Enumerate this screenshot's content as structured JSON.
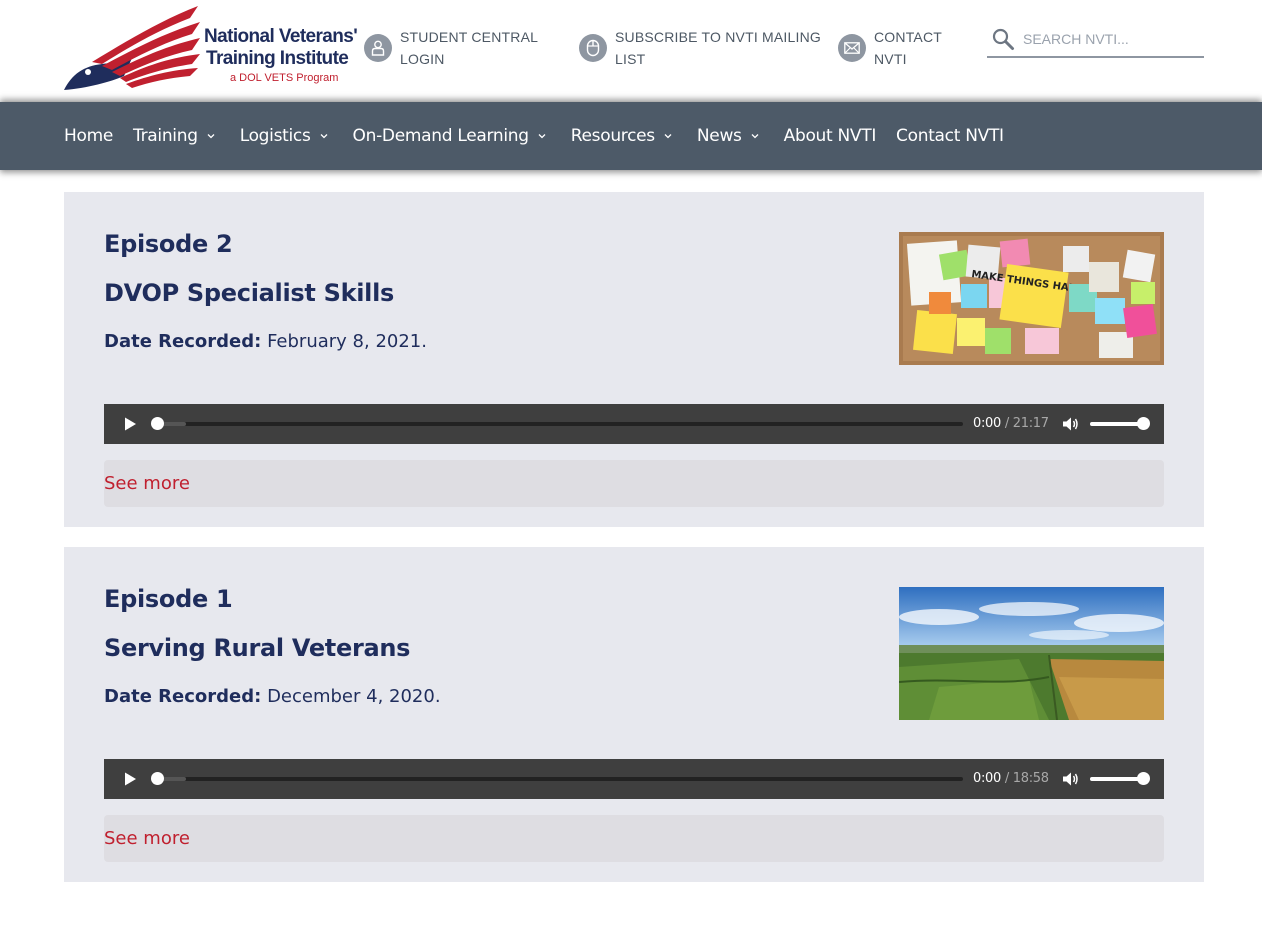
{
  "header": {
    "logo": {
      "line1": "National Veterans'",
      "line2": "Training Institute",
      "line3": "a DOL VETS Program"
    },
    "utility_links": {
      "login": "STUDENT CENTRAL LOGIN",
      "subscribe": "SUBSCRIBE TO NVTI MAILING LIST",
      "contact": "CONTACT NVTI"
    },
    "search": {
      "placeholder": "SEARCH NVTI..."
    }
  },
  "nav": {
    "items": [
      {
        "label": "Home",
        "has_dropdown": false
      },
      {
        "label": "Training",
        "has_dropdown": true
      },
      {
        "label": "Logistics",
        "has_dropdown": true
      },
      {
        "label": "On-Demand Learning",
        "has_dropdown": true
      },
      {
        "label": "Resources",
        "has_dropdown": true
      },
      {
        "label": "News",
        "has_dropdown": true
      },
      {
        "label": "About NVTI",
        "has_dropdown": false
      },
      {
        "label": "Contact NVTI",
        "has_dropdown": false
      }
    ]
  },
  "episodes": [
    {
      "number": "Episode 2",
      "title": "DVOP Specialist Skills",
      "date_label": "Date Recorded:",
      "date_value": "February 8, 2021.",
      "image_icon": "cork-board-sticky-notes",
      "image_text": "MAKE THINGS HAPPEN",
      "player": {
        "current": "0:00",
        "duration": "/ 21:17"
      },
      "see_more": "See more"
    },
    {
      "number": "Episode 1",
      "title": "Serving Rural Veterans",
      "date_label": "Date Recorded:",
      "date_value": "December 4, 2020.",
      "image_icon": "rural-farmland-landscape",
      "player": {
        "current": "0:00",
        "duration": "/ 18:58"
      },
      "see_more": "See more"
    }
  ],
  "colors": {
    "navy": "#1f2d5c",
    "nav_bg": "#4d5a68",
    "card_bg": "#e7e8ee",
    "accent_red": "#c0202f",
    "player_bg": "#3f3f3f"
  }
}
